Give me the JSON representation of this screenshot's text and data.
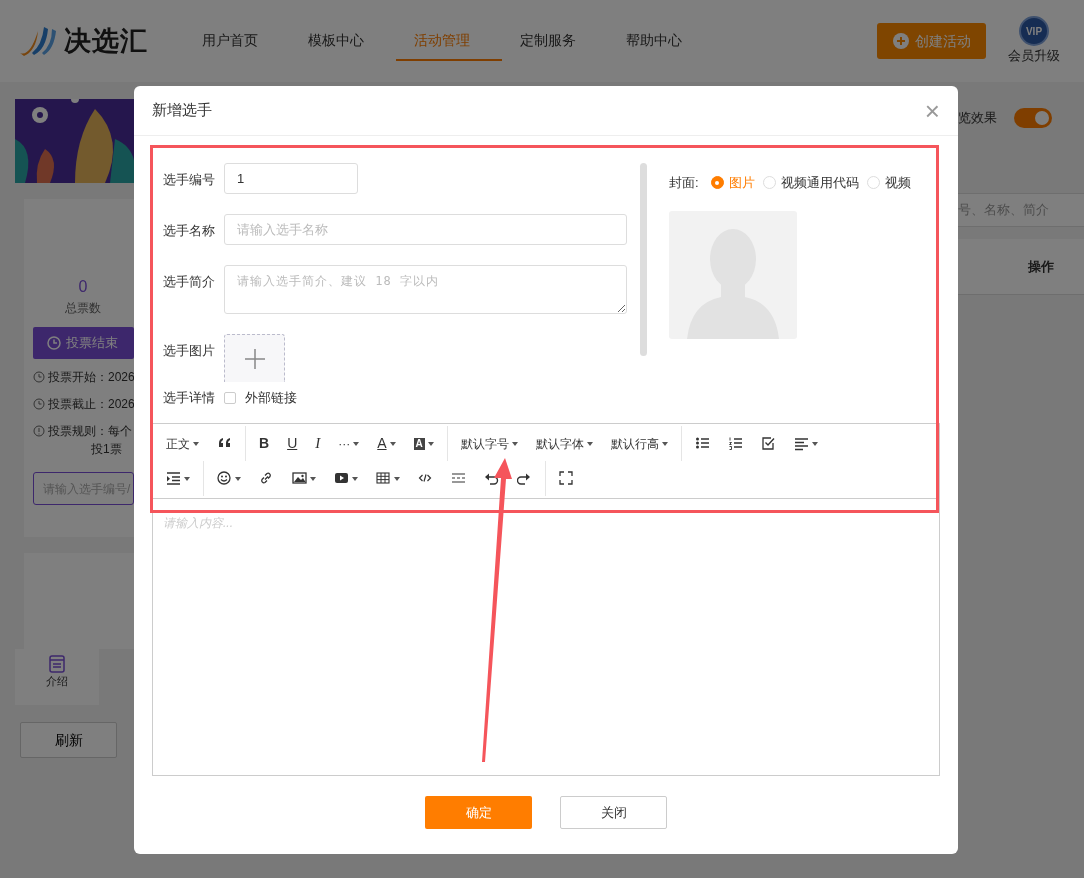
{
  "header": {
    "logo_text": "决选汇",
    "nav": [
      {
        "label": "用户首页",
        "selected": false
      },
      {
        "label": "模板中心",
        "selected": false
      },
      {
        "label": "活动管理",
        "selected": true
      },
      {
        "label": "定制服务",
        "selected": false
      },
      {
        "label": "帮助中心",
        "selected": false
      }
    ],
    "create_button": "创建活动",
    "vip_badge": "VIP",
    "vip_label": "会员升级"
  },
  "sidebar": {
    "votes": "0",
    "votes_label": "总票数",
    "status_button": "投票结束",
    "info_lines": [
      {
        "kind": "clock",
        "text": "投票开始：2026"
      },
      {
        "kind": "clock",
        "text": "投票截止：2026"
      },
      {
        "kind": "alert",
        "text": "投票规则：每个",
        "continuation": "投1票"
      }
    ],
    "search_placeholder": "请输入选手编号/",
    "bottom_nav": [
      {
        "label": "介绍"
      }
    ],
    "refresh_button": "刷新"
  },
  "main": {
    "preview": {
      "label": "览效果",
      "on": true
    },
    "search_placeholder": "号、名称、简介",
    "table": {
      "columns": [
        "操作"
      ]
    }
  },
  "modal": {
    "title": "新增选手",
    "close": "×",
    "fields": [
      {
        "kind": "input",
        "label": "选手编号",
        "value": "1"
      },
      {
        "kind": "input",
        "label": "选手名称",
        "placeholder": "请输入选手名称"
      },
      {
        "kind": "textarea",
        "label": "选手简介",
        "placeholder": "请输入选手简介、建议 18 字以内"
      },
      {
        "kind": "upload",
        "label": "选手图片"
      },
      {
        "kind": "checkbox",
        "label": "选手详情",
        "option": "外部链接",
        "checked": false
      }
    ],
    "cover": {
      "label": "封面:",
      "options": [
        {
          "label": "图片",
          "selected": true
        },
        {
          "label": "视频通用代码",
          "selected": false
        },
        {
          "label": "视频",
          "selected": false
        }
      ]
    },
    "toolbar_rows": [
      {
        "groups": [
          [
            {
              "kind": "text",
              "label": "正文",
              "dropdown": true
            },
            {
              "kind": "icon",
              "dropdown": false
            }
          ],
          [
            {
              "kind": "glyph",
              "label": "B",
              "dropdown": false
            },
            {
              "kind": "glyph",
              "label": "U",
              "dropdown": false
            },
            {
              "kind": "glyph",
              "label": "I",
              "dropdown": false
            },
            {
              "kind": "glyph",
              "label": "···",
              "dropdown": true
            },
            {
              "kind": "glyph",
              "label": "A",
              "dropdown": true
            },
            {
              "kind": "glyph",
              "label": "A",
              "dropdown": true
            }
          ],
          [
            {
              "kind": "text",
              "label": "默认字号",
              "dropdown": true
            },
            {
              "kind": "text",
              "label": "默认字体",
              "dropdown": true
            },
            {
              "kind": "text",
              "label": "默认行高",
              "dropdown": true
            }
          ],
          [
            {
              "kind": "icon",
              "dropdown": false
            },
            {
              "kind": "icon",
              "dropdown": false
            },
            {
              "kind": "icon",
              "dropdown": false
            },
            {
              "kind": "icon",
              "dropdown": true
            }
          ]
        ]
      },
      {
        "groups": [
          [
            {
              "kind": "icon",
              "dropdown": true
            }
          ],
          [
            {
              "kind": "icon",
              "dropdown": true
            },
            {
              "kind": "icon",
              "dropdown": false
            },
            {
              "kind": "icon",
              "dropdown": true
            },
            {
              "kind": "icon",
              "dropdown": true
            },
            {
              "kind": "icon",
              "dropdown": true
            },
            {
              "kind": "icon",
              "dropdown": false
            },
            {
              "kind": "icon",
              "dropdown": false
            },
            {
              "kind": "icon",
              "dropdown": false
            },
            {
              "kind": "icon",
              "dropdown": false
            }
          ],
          [
            {
              "kind": "icon",
              "dropdown": false
            }
          ]
        ]
      }
    ],
    "editor_placeholder": "请输入内容...",
    "buttons": [
      {
        "kind": "primary",
        "label": "确定"
      },
      {
        "kind": "secondary",
        "label": "关闭"
      }
    ]
  },
  "annotation": {
    "frame": true,
    "arrow": true
  }
}
